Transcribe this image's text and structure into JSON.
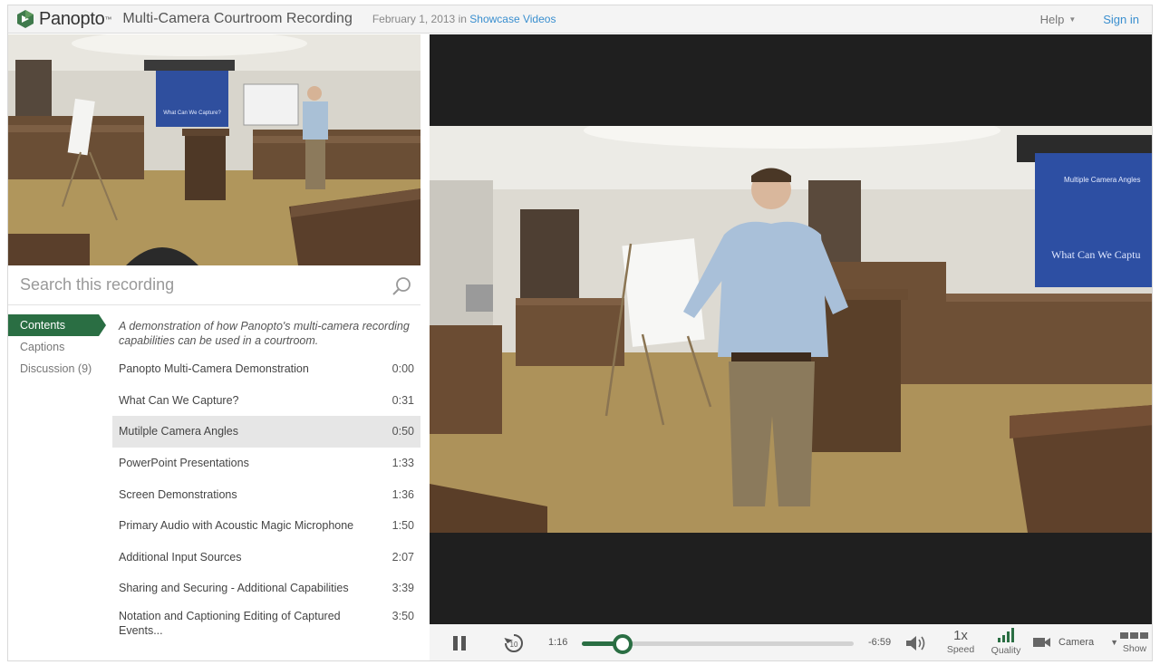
{
  "header": {
    "logo_text": "Panopto",
    "title": "Multi-Camera Courtroom Recording",
    "date": "February 1, 2013",
    "in_word": "in",
    "folder": "Showcase Videos",
    "help": "Help",
    "signin": "Sign in"
  },
  "search": {
    "placeholder": "Search this recording"
  },
  "nav": {
    "items": [
      {
        "label": "Contents"
      },
      {
        "label": "Captions"
      },
      {
        "label": "Discussion (9)"
      }
    ]
  },
  "toc": {
    "description": "A demonstration of how Panopto's multi-camera recording capabilities can be used in a courtroom.",
    "entries": [
      {
        "title": "Panopto Multi-Camera Demonstration",
        "time": "0:00"
      },
      {
        "title": "What Can We Capture?",
        "time": "0:31"
      },
      {
        "title": "Mutilple Camera Angles",
        "time": "0:50"
      },
      {
        "title": "PowerPoint Presentations",
        "time": "1:33"
      },
      {
        "title": "Screen Demonstrations",
        "time": "1:36"
      },
      {
        "title": "Primary Audio with Acoustic Magic Microphone",
        "time": "1:50"
      },
      {
        "title": "Additional Input Sources",
        "time": "2:07"
      },
      {
        "title": "Sharing and Securing - Additional Capabilities",
        "time": "3:39"
      },
      {
        "title": "Notation and Captioning Editing of Captured Events...",
        "time": "3:50"
      }
    ]
  },
  "slide": {
    "thumb_text": "What Can We Capture?",
    "main_heading": "Multiple Camera Angles",
    "main_text": "What Can We Captu"
  },
  "player": {
    "current_time": "1:16",
    "remaining_time": "-6:59",
    "progress_fraction": 0.15,
    "speed_value": "1x",
    "speed_label": "Speed",
    "quality_label": "Quality",
    "camera_label": "Camera",
    "show_label": "Show"
  },
  "colors": {
    "accent": "#2a6e43",
    "link": "#3a8fcf"
  }
}
